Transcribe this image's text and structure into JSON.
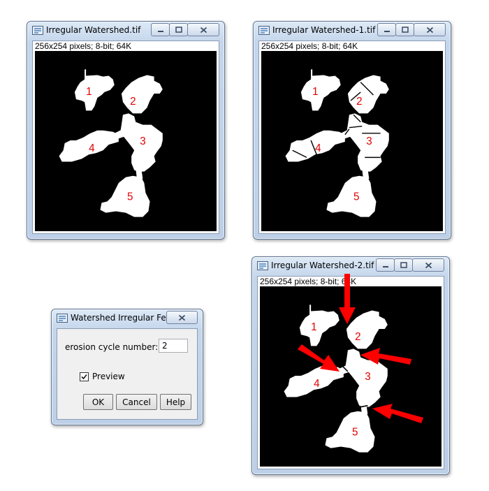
{
  "windows": [
    {
      "id": "win1",
      "title": "Irregular Watershed.tif",
      "info": "256x254 pixels; 8-bit; 64K",
      "labels": [
        "1",
        "2",
        "3",
        "4",
        "5"
      ]
    },
    {
      "id": "win2",
      "title": "Irregular Watershed-1.tif",
      "info": "256x254 pixels; 8-bit; 64K",
      "labels": [
        "1",
        "2",
        "3",
        "4",
        "5"
      ]
    },
    {
      "id": "win3",
      "title": "Irregular Watershed-2.tif",
      "info": "256x254 pixels; 8-bit; 64K",
      "labels": [
        "1",
        "2",
        "3",
        "4",
        "5"
      ]
    }
  ],
  "dialog": {
    "title": "Watershed Irregular Fe...",
    "field_label": "erosion cycle number:",
    "field_value": "2",
    "preview_label": "Preview",
    "preview_checked": true,
    "buttons": {
      "ok": "OK",
      "cancel": "Cancel",
      "help": "Help"
    }
  },
  "colors": {
    "label_red": "#e30000",
    "arrow_red": "#ff0000",
    "canvas_bg": "#000000",
    "blob": "#ffffff"
  },
  "icons": [
    "imagej-icon",
    "minimize-icon",
    "maximize-icon",
    "close-icon"
  ]
}
